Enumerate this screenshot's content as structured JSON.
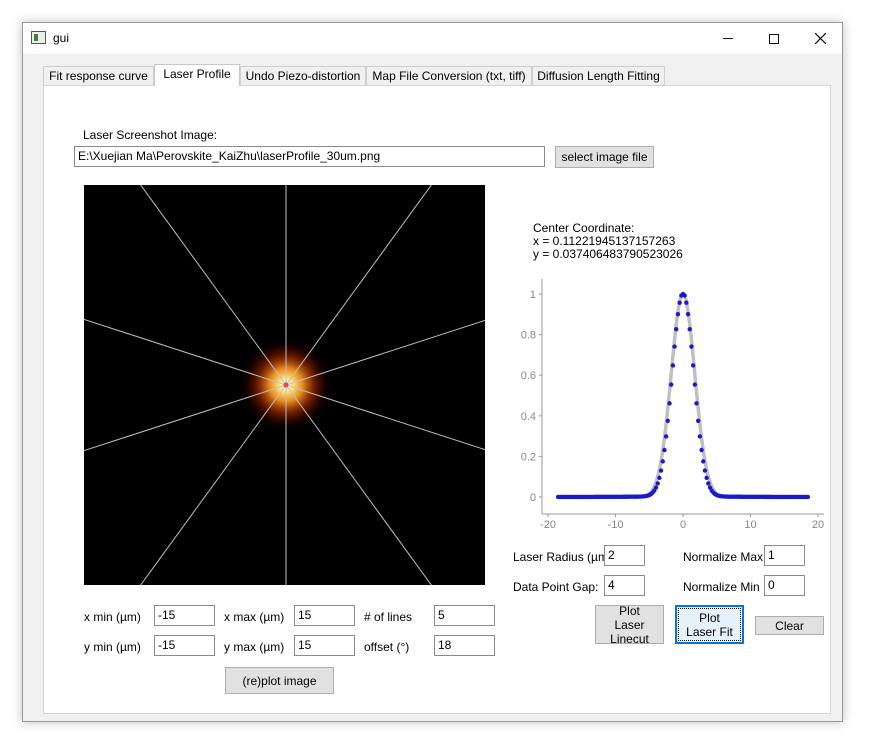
{
  "window": {
    "title": "gui",
    "minimize_icon": "minimize-icon",
    "maximize_icon": "maximize-icon",
    "close_icon": "close-icon"
  },
  "tabs": [
    {
      "label": "Fit response curve",
      "active": false
    },
    {
      "label": "Laser Profile",
      "active": true
    },
    {
      "label": "Undo Piezo-distortion",
      "active": false
    },
    {
      "label": "Map File Conversion (txt, tiff)",
      "active": false
    },
    {
      "label": "Diffusion Length Fitting",
      "active": false
    }
  ],
  "laser": {
    "screenshot_label": "Laser Screenshot Image:",
    "file_path": "E:\\Xuejian Ma\\Perovskite_KaiZhu\\laserProfile_30um.png",
    "select_button": "select image file",
    "image": {
      "num_lines": 5,
      "offset_deg": 18,
      "background": "#000000",
      "line_color": "#bfbfbf",
      "glow_colors": [
        "#ffffff",
        "#ffe080",
        "#ff9a20",
        "#c03000",
        "#300000"
      ]
    }
  },
  "center": {
    "title": "Center Coordinate:",
    "x_text": "x = 0.11221945137157263",
    "y_text": "y = 0.037406483790523026"
  },
  "controls": {
    "xmin_label": "x min (µm)",
    "xmin": "-15",
    "xmax_label": "x max (µm)",
    "xmax": "15",
    "lines_label": "# of lines",
    "lines": "5",
    "ymin_label": "y min (µm)",
    "ymin": "-15",
    "ymax_label": "y max (µm)",
    "ymax": "15",
    "offset_label": "offset (°)",
    "offset": "18",
    "replot_button": "(re)plot image",
    "radius_label": "Laser Radius (µm):",
    "radius": "2",
    "gap_label": "Data Point Gap:",
    "gap": "4",
    "normmax_label": "Normalize Max",
    "normmax": "1",
    "normmin_label": "Normalize Min",
    "normmin": "0",
    "plot_linecut_line1": "Plot",
    "plot_linecut_line2": "Laser Linecut",
    "plot_fit_line1": "Plot",
    "plot_fit_line2": "Laser Fit",
    "clear_button": "Clear"
  },
  "chart_data": {
    "type": "scatter",
    "title": "",
    "xlabel": "",
    "ylabel": "",
    "xlim": [
      -20,
      20
    ],
    "ylim": [
      0,
      1
    ],
    "x_ticks": [
      "-20",
      "-10",
      "0",
      "10",
      "20"
    ],
    "y_ticks": [
      "0",
      "0.2",
      "0.4",
      "0.6",
      "0.8",
      "1"
    ],
    "grid": false,
    "series": [
      {
        "kind": "points",
        "color": "#1a1acc",
        "x_range": [
          -18.5,
          18.5
        ],
        "center": 0,
        "sigma": 1.6,
        "background": 0.005
      },
      {
        "kind": "fit-line",
        "color": "#c0c0c0",
        "x_range": [
          -18.5,
          18.5
        ],
        "center": 0,
        "sigma": 1.75
      }
    ]
  }
}
